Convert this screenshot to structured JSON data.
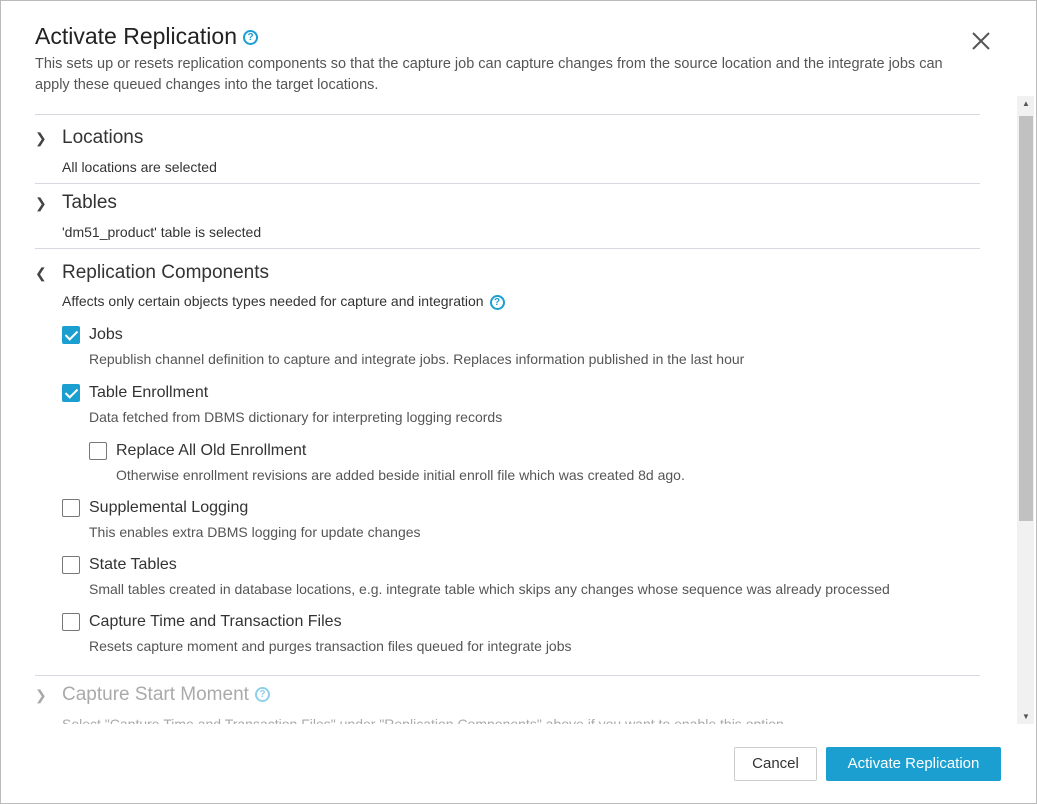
{
  "dialog": {
    "title": "Activate Replication",
    "description": "This sets up or resets replication components so that the capture job can capture changes from the source location and the integrate jobs can apply these queued changes into the target locations."
  },
  "sections": {
    "locations": {
      "title": "Locations",
      "summary": "All locations are selected"
    },
    "tables": {
      "title": "Tables",
      "summary": "'dm51_product' table is selected"
    },
    "components": {
      "title": "Replication Components",
      "summary": "Affects only certain objects types needed for capture and integration",
      "items": [
        {
          "label": "Jobs",
          "hint": "Republish channel definition to capture and integrate jobs. Replaces information published in the last hour",
          "checked": true
        },
        {
          "label": "Table Enrollment",
          "hint": "Data fetched from DBMS dictionary for interpreting logging records",
          "checked": true
        },
        {
          "label": "Replace All Old Enrollment",
          "hint": "Otherwise enrollment revisions are added beside initial enroll file which was created 8d ago.",
          "checked": false
        },
        {
          "label": "Supplemental Logging",
          "hint": "This enables extra DBMS logging for update changes",
          "checked": false
        },
        {
          "label": "State Tables",
          "hint": "Small tables created in database locations, e.g. integrate table which skips any changes whose sequence was already processed",
          "checked": false
        },
        {
          "label": "Capture Time and Transaction Files",
          "hint": "Resets capture moment and purges transaction files queued for integrate jobs",
          "checked": false
        }
      ]
    },
    "capture_start": {
      "title": "Capture Start Moment",
      "summary": "Select \"Capture Time and Transaction Files\" under \"Replication Components\" above if you want to enable this option.",
      "disabled": true
    }
  },
  "footer": {
    "cancel": "Cancel",
    "activate": "Activate Replication"
  },
  "colors": {
    "accent": "#1a9fd0"
  }
}
